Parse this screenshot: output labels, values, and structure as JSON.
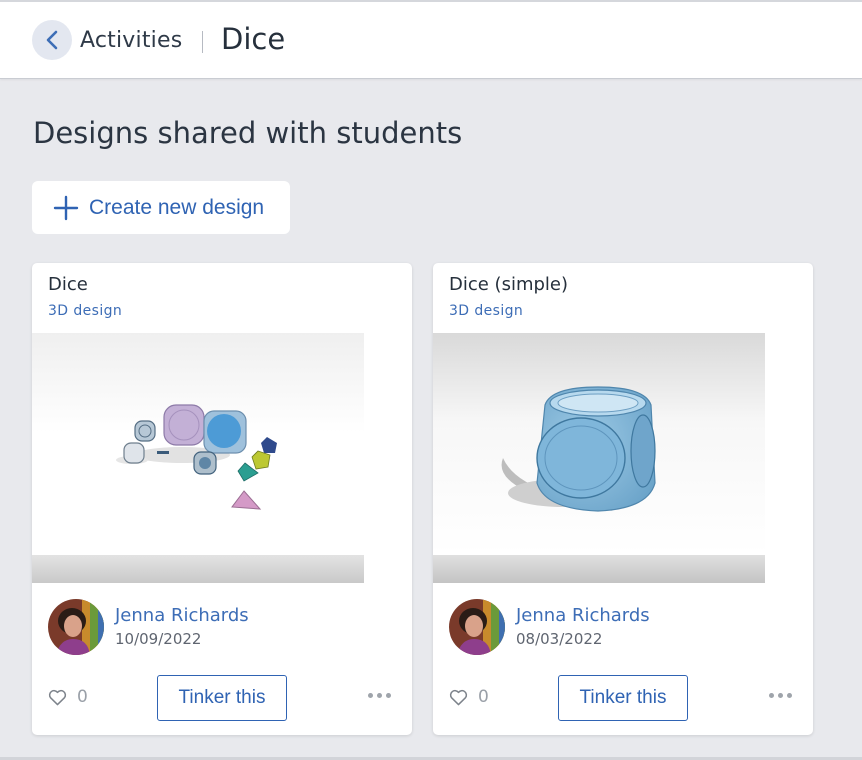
{
  "header": {
    "back_icon": "chevron-left-icon",
    "breadcrumb": "Activities",
    "title": "Dice"
  },
  "main": {
    "heading": "Designs shared with students",
    "create_button": {
      "icon": "plus-icon",
      "label": "Create new design"
    },
    "designs": [
      {
        "title": "Dice",
        "type": "3D design",
        "author": "Jenna Richards",
        "date": "10/09/2022",
        "likes": "0",
        "action": "Tinker this"
      },
      {
        "title": "Dice (simple)",
        "type": "3D design",
        "author": "Jenna Richards",
        "date": "08/03/2022",
        "likes": "0",
        "action": "Tinker this"
      }
    ]
  },
  "colors": {
    "accent": "#2f63b3",
    "link": "#3d6db6",
    "background": "#e8e9ed",
    "card": "#ffffff"
  }
}
